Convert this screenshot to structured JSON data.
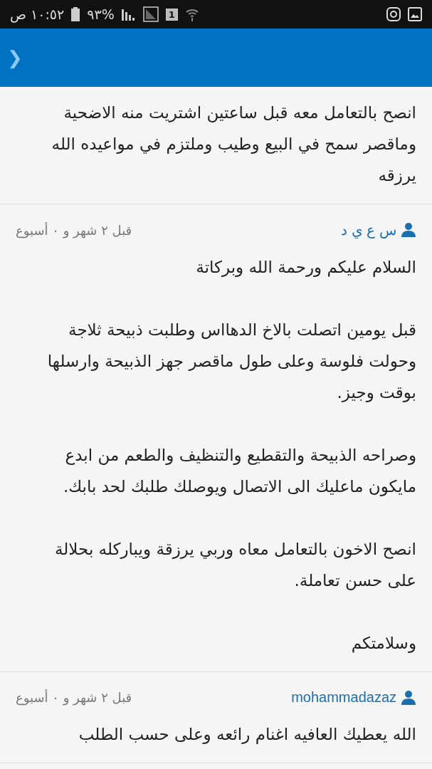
{
  "status_bar": {
    "time": "١٠:٥٢ ص",
    "battery": "%٩٣",
    "sim": "1"
  },
  "header": {
    "nav_glyph": "❯"
  },
  "comments": [
    {
      "paragraphs": [
        "انصح بالتعامل معه قبل ساعتين اشتريت منه الاضحية\nوماقصر سمح في البيع وطيب وملتزم في مواعيده الله\nيرزقه"
      ]
    },
    {
      "author": "س ع ي د",
      "time": "قبل ٢ شهر و ٠ أسبوع",
      "paragraphs": [
        "السلام عليكم ورحمة الله وبركاتة",
        "قبل يومين اتصلت بالاخ الدهااس وطلبت ذبيحة ثلاجة\nوحولت فلوسة وعلى طول ماقصر جهز الذبيحة وارسلها\nبوقت وجيز.",
        "وصراحه الذبيحة والتقطيع والتنظيف والطعم من ابدع\nمايكون ماعليك الى الاتصال ويوصلك طلبك لحد بابك.",
        "انصح الاخون بالتعامل معاه وربي يرزقة ويباركله بحلالة\nعلى حسن تعاملة.",
        "وسلامتكم"
      ]
    },
    {
      "author": "mohammadazaz",
      "time": "قبل ٢ شهر و ٠ أسبوع",
      "paragraphs": [
        "الله يعطيك العافيه اغنام رائعه وعلى حسب الطلب"
      ]
    }
  ]
}
